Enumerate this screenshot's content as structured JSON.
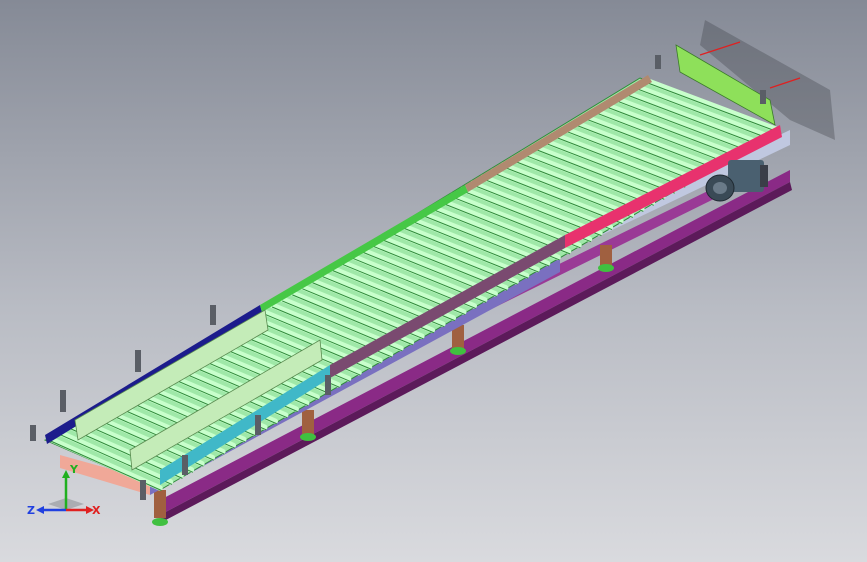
{
  "triad": {
    "x_label": "X",
    "y_label": "Y",
    "z_label": "Z",
    "x_color": "#e02020",
    "y_color": "#20b020",
    "z_color": "#2040e0"
  },
  "colors": {
    "roller_fill": "#aef5b4",
    "roller_edge": "#2f8a3a",
    "frame_green": "#46c846",
    "side_pink": "#e8326e",
    "side_blue": "#1c1c8c",
    "leg_purple": "#8a2a86",
    "motor": "#4a6070",
    "guide_fill": "#c4ecb8"
  }
}
